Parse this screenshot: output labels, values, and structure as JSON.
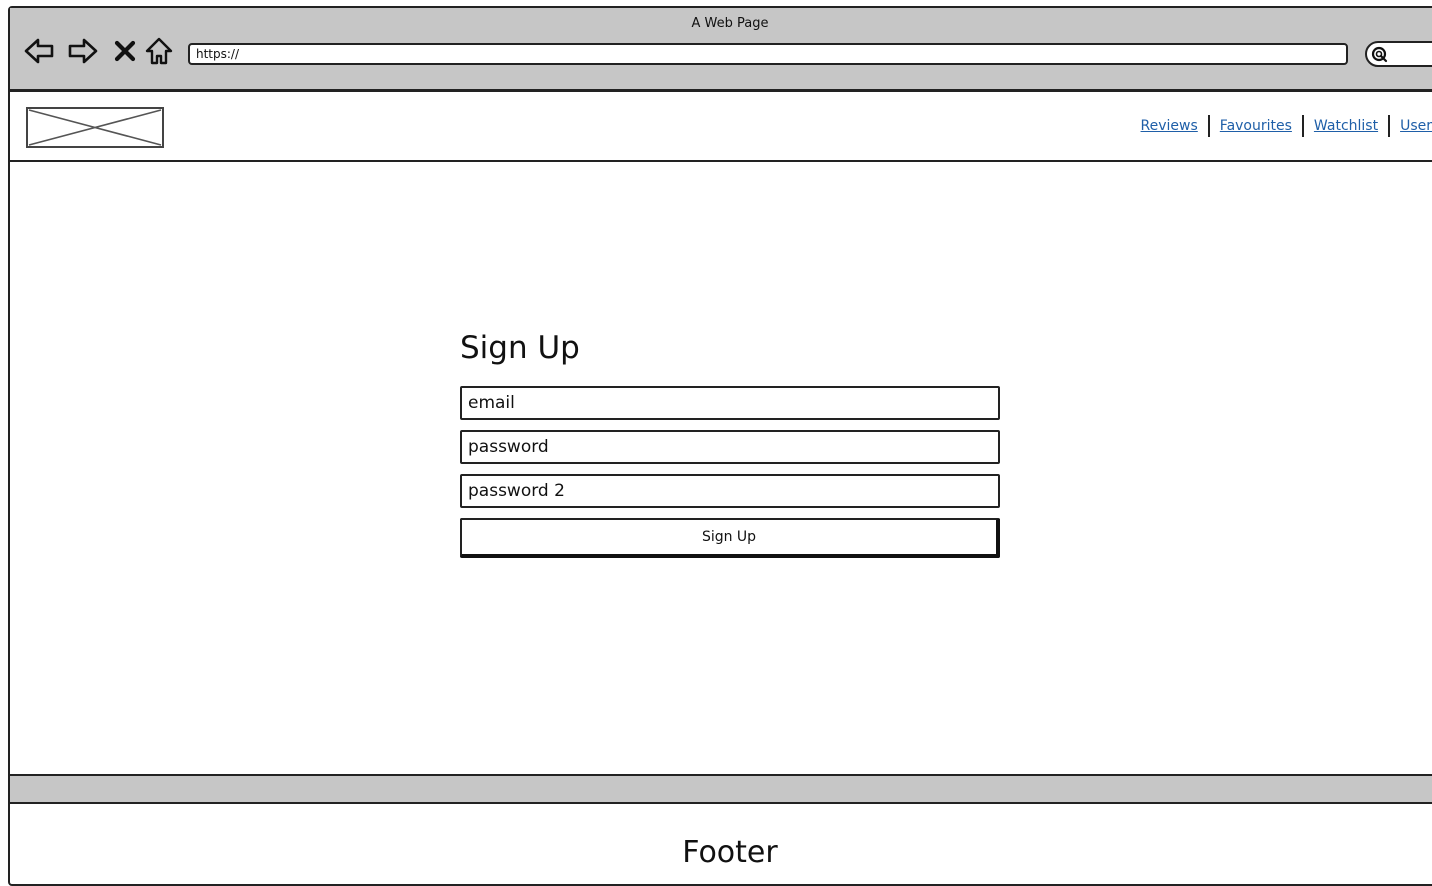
{
  "window": {
    "title": "A Web Page"
  },
  "browser": {
    "url": "https://",
    "buttons": [
      "back-icon",
      "forward-icon",
      "close-icon",
      "home-icon",
      "search-icon"
    ]
  },
  "header": {
    "nav": [
      {
        "label": "Reviews"
      },
      {
        "label": "Favourites"
      },
      {
        "label": "Watchlist"
      },
      {
        "label": "User"
      }
    ],
    "link_color": "#1f5fa8"
  },
  "signup": {
    "title": "Sign Up",
    "fields": {
      "email_placeholder": "email",
      "password_placeholder": "password",
      "password2_placeholder": "password 2"
    },
    "submit_label": "Sign Up"
  },
  "footer": {
    "text": "Footer"
  },
  "colors": {
    "chrome": "#c6c6c6",
    "border": "#222222"
  }
}
